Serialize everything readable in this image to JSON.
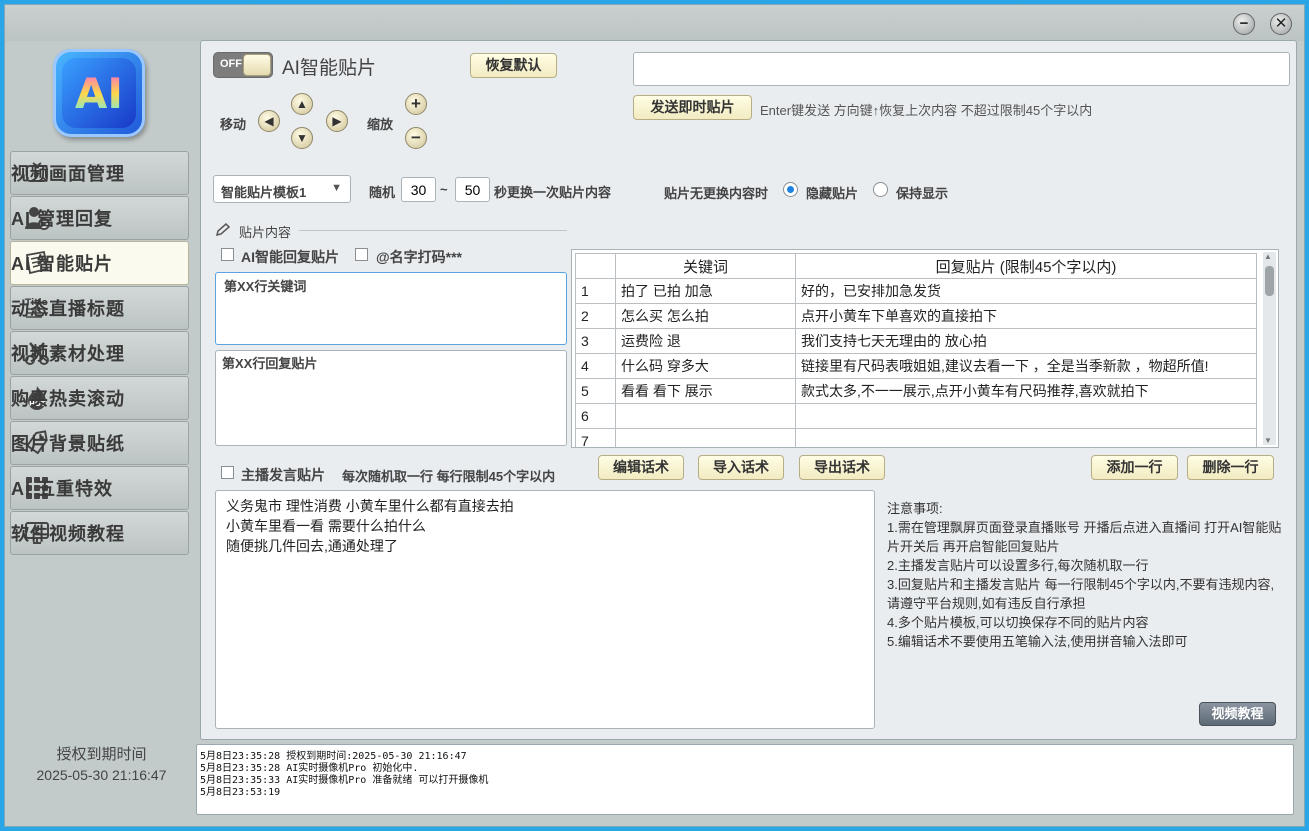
{
  "titlebar": {
    "minimize": "−",
    "close": "✕"
  },
  "logo": {
    "text": "AI"
  },
  "sidebar": {
    "items": [
      {
        "label": "视频画面管理",
        "icon": "video-screen-icon"
      },
      {
        "label": "AI 管理回复",
        "icon": "user-gear-icon"
      },
      {
        "label": "AI 智能贴片",
        "icon": "sticker-note-icon",
        "active": true
      },
      {
        "label": "动态直播标题",
        "icon": "title-text-icon"
      },
      {
        "label": "视频素材处理",
        "icon": "scissors-icon"
      },
      {
        "label": "购买热卖滚动",
        "icon": "hot-fire-icon"
      },
      {
        "label": "图片背景贴纸",
        "icon": "tag-icon"
      },
      {
        "label": "AI 五重特效",
        "icon": "grid-dots-icon"
      },
      {
        "label": "软件视频教程",
        "icon": "monitor-tutorial-icon"
      }
    ],
    "auth_label": "授权到期时间",
    "auth_date": "2025-05-30 21:16:47"
  },
  "main": {
    "toggle": {
      "state": "OFF"
    },
    "title": "AI智能贴片",
    "restore_button": "恢复默认",
    "send_input": {
      "value": ""
    },
    "send_button": "发送即时贴片",
    "send_hint": "Enter键发送 方向键↑恢复上次内容 不超过限制45个字以内",
    "move_label": "移动",
    "zoom_label": "缩放",
    "template_select": "智能贴片模板1",
    "random_label": "随机",
    "random_min": "30",
    "tilde": "~",
    "random_max": "50",
    "interval_suffix": "秒更换一次贴片内容",
    "no_change_label": "贴片无更换内容时",
    "radio_hide": "隐藏贴片",
    "radio_keep": "保持显示",
    "section_title": "贴片内容",
    "ai_reply_check": "AI智能回复贴片",
    "name_mask_check": "@名字打码***",
    "keyword_placeholder": "第XX行关键词",
    "reply_placeholder": "第XX行回复贴片",
    "table": {
      "headers": [
        "",
        "关键词",
        "回复贴片 (限制45个字以内)"
      ],
      "rows": [
        [
          "1",
          "拍了 已拍 加急",
          "好的，已安排加急发货"
        ],
        [
          "2",
          "怎么买 怎么拍",
          "点开小黄车下单喜欢的直接拍下"
        ],
        [
          "3",
          "运费险 退",
          "我们支持七天无理由的   放心拍"
        ],
        [
          "4",
          "什么码 穿多大",
          "链接里有尺码表哦姐姐,建议去看一下 ，全是当季新款 ，物超所值!"
        ],
        [
          "5",
          "看看 看下 展示",
          "款式太多,不一一展示,点开小黄车有尺码推荐,喜欢就拍下"
        ],
        [
          "6",
          "",
          ""
        ],
        [
          "7",
          "",
          ""
        ]
      ]
    },
    "host_check": "主播发言贴片",
    "host_hint": "每次随机取一行 每行限制45个字以内",
    "buttons": {
      "edit": "编辑话术",
      "import": "导入话术",
      "export": "导出话术",
      "add_row": "添加一行",
      "delete_row": "删除一行",
      "tutorial": "视频教程"
    },
    "host_lines": [
      "义务鬼市 理性消费 小黄车里什么都有直接去拍",
      "小黄车里看一看 需要什么拍什么",
      "随便挑几件回去,通通处理了"
    ],
    "notes": [
      "注意事项:",
      "1.需在管理飘屏页面登录直播账号  开播后点进入直播间  打开AI智能贴片开关后 再开启智能回复贴片",
      "2.主播发言贴片可以设置多行,每次随机取一行",
      "3.回复贴片和主播发言贴片 每一行限制45个字以内,不要有违规内容,请遵守平台规则,如有违反自行承担",
      "4.多个贴片模板,可以切换保存不同的贴片内容",
      "5.编辑话术不要使用五笔输入法,使用拼音输入法即可"
    ]
  },
  "log": {
    "lines": [
      "5月8日23:35:28 授权到期时间:2025-05-30 21:16:47",
      "5月8日23:35:28 AI实时摄像机Pro 初始化中.",
      "5月8日23:35:33 AI实时摄像机Pro 准备就绪 可以打开摄像机",
      "5月8日23:53:19"
    ]
  },
  "colors": {
    "accent": "#1d82e0",
    "button_bg": "#f7f2d4",
    "active_nav": "#fbfaee"
  }
}
